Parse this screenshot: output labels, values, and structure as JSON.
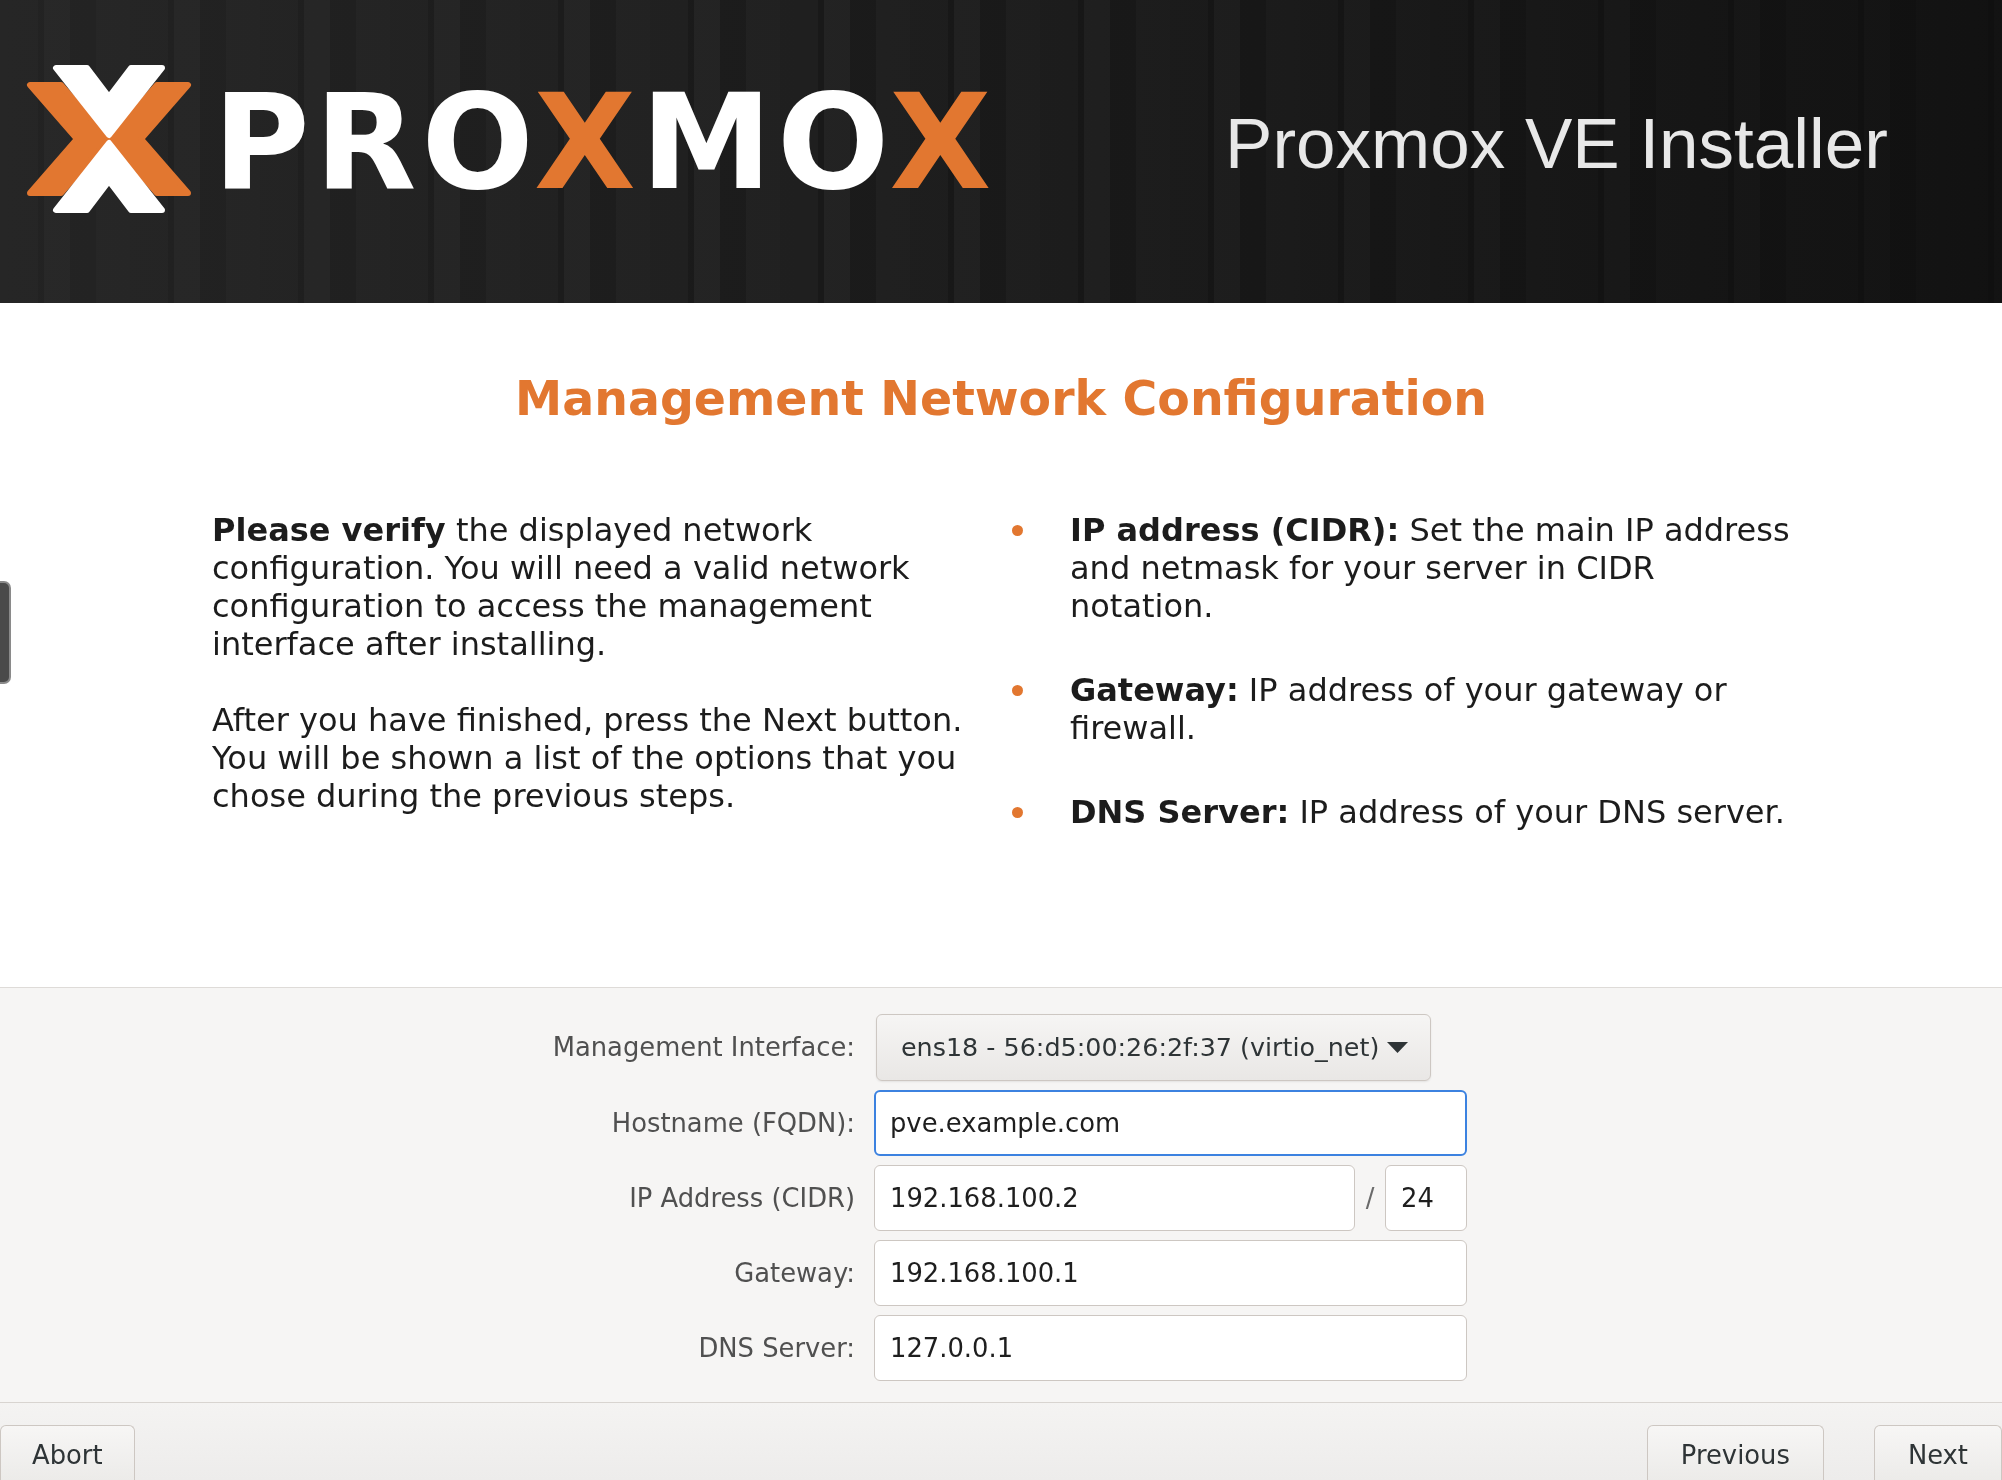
{
  "header": {
    "logo": {
      "wordmark": [
        {
          "text": "PRO",
          "color": "#ffffff"
        },
        {
          "text": "X",
          "color": "#e27730"
        },
        {
          "text": "MO",
          "color": "#ffffff"
        },
        {
          "text": "X",
          "color": "#e27730"
        }
      ]
    },
    "title": "Proxmox VE Installer"
  },
  "page": {
    "heading": "Management Network Configuration",
    "intro": [
      "**Please verify** the displayed network configuration. You will need a valid network configuration to access the management interface after installing.",
      "After you have finished, press the Next button. You will be shown a list of the options that you chose during the previous steps."
    ],
    "hints": [
      "**IP address (CIDR):** Set the main IP address and netmask for your server in CIDR notation.",
      "**Gateway:** IP address of your gateway or firewall.",
      "**DNS Server:** IP address of your DNS server."
    ]
  },
  "form": {
    "fields": [
      {
        "kind": "dropdown",
        "label": "Management Interface:",
        "value": "ens18 - 56:d5:00:26:2f:37 (virtio_net)",
        "focused": false
      },
      {
        "kind": "text",
        "label": "Hostname (FQDN):",
        "value": "pve.example.com",
        "focused": true
      },
      {
        "kind": "cidr",
        "label": "IP Address (CIDR)",
        "value": "192.168.100.2",
        "separator": "/",
        "prefix": "24",
        "focused": false
      },
      {
        "kind": "text",
        "label": "Gateway:",
        "value": "192.168.100.1",
        "focused": false
      },
      {
        "kind": "text",
        "label": "DNS Server:",
        "value": "127.0.0.1",
        "focused": false
      }
    ]
  },
  "buttons_left": [
    "Abort"
  ],
  "buttons_right": [
    "Previous",
    "Next"
  ]
}
